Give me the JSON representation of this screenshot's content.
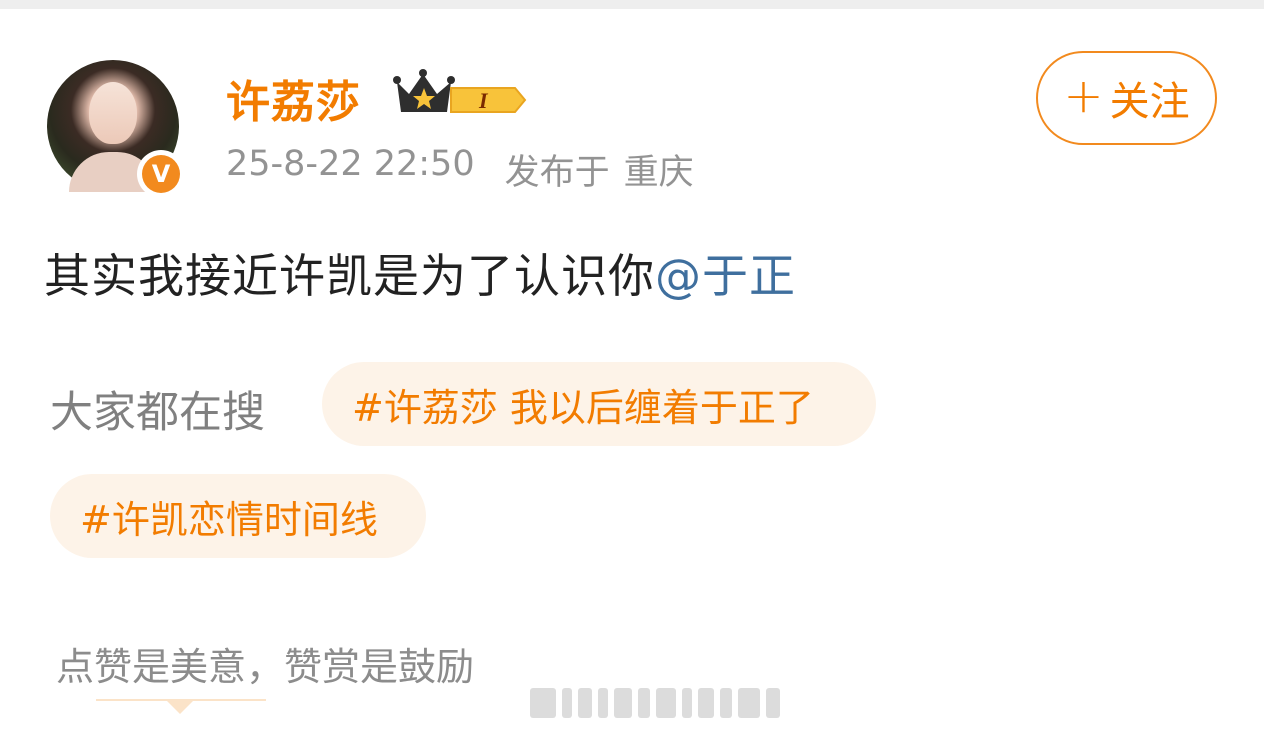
{
  "post": {
    "username": "许荔莎",
    "level_badge": "I",
    "timestamp": "25-8-22 22:50",
    "publish_prefix": "发布于",
    "location": "重庆",
    "follow_label": "关注",
    "text": "其实我接近许凯是为了认识你",
    "mention": "@于正"
  },
  "search": {
    "label": "大家都在搜",
    "topics": [
      "#许荔莎 我以后缠着于正了",
      "#许凯恋情时间线"
    ]
  },
  "reward": {
    "text": "点赞是美意，赞赏是鼓励"
  },
  "colors": {
    "accent": "#f27c00",
    "mention": "#3f6f9e",
    "pill_bg": "#fdf3e8"
  },
  "icons": [
    "avatar",
    "verified-v-icon",
    "crown-level-icon",
    "plus-icon"
  ]
}
